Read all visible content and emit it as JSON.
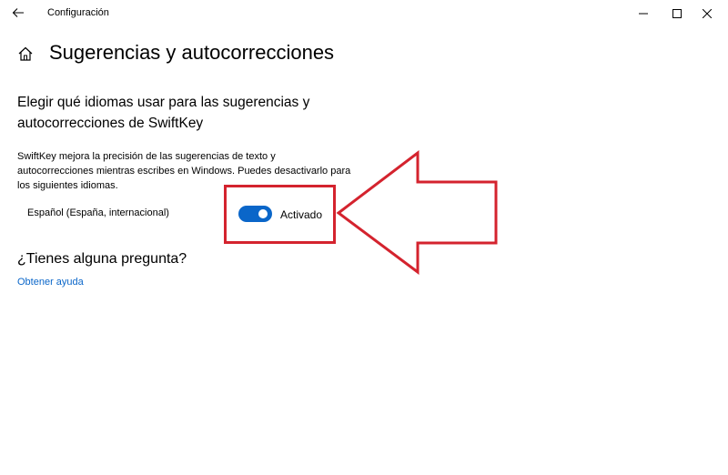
{
  "window": {
    "title": "Configuración",
    "controls": [
      "minimize-icon",
      "maximize-icon",
      "close-icon"
    ]
  },
  "nav": {
    "back_icon": "back-arrow-icon",
    "home_icon": "home-icon"
  },
  "page": {
    "title": "Sugerencias y autocorrecciones",
    "section_heading": "Elegir qué idiomas usar para las sugerencias y autocorrecciones de SwiftKey",
    "description": "SwiftKey mejora la precisión de las sugerencias de texto y autocorrecciones mientras escribes en Windows. Puedes desactivarlo para los siguientes idiomas."
  },
  "languages": [
    {
      "label": "Español (España, internacional)",
      "enabled": true,
      "state_label": "Activado"
    }
  ],
  "help": {
    "heading": "¿Tienes alguna pregunta?",
    "link": "Obtener ayuda"
  },
  "annotation": {
    "color": "#d4232e"
  },
  "colors": {
    "accent": "#0a66c9",
    "annotation_red": "#d4232e"
  }
}
